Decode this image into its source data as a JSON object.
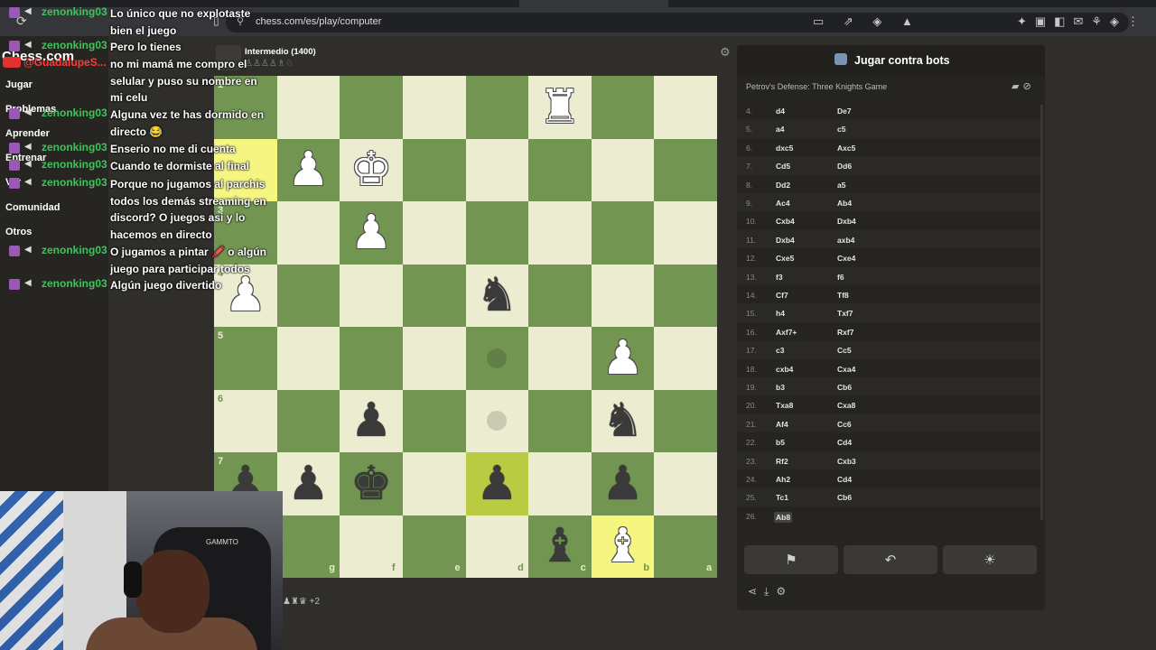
{
  "browser": {
    "url": "chess.com/es/play/computer"
  },
  "nav": {
    "logo": "Chess.com",
    "items": [
      "Jugar",
      "Problemas",
      "Aprender",
      "Entrenar",
      "Ver",
      "Comunidad",
      "Otros"
    ]
  },
  "chat": {
    "mention": "@GuadalupeS...",
    "messages": [
      {
        "user": "zenonking03",
        "text": "Lo único que no explotaste bien el juego"
      },
      {
        "user": "zenonking03",
        "text": "Pero lo tienes"
      },
      {
        "user": "",
        "text": "no mi mamá me compro el selular y puso su nombre en mi celu"
      },
      {
        "user": "zenonking03",
        "text": "Alguna vez te has dormido en directo 😂"
      },
      {
        "user": "zenonking03",
        "text": "Enserio no me di cuenta"
      },
      {
        "user": "zenonking03",
        "text": "Cuando te dormiste al final"
      },
      {
        "user": "zenonking03",
        "text": "Porque no jugamos al parchis todos los demás streaming en discord? O juegos asi y lo hacemos en directo"
      },
      {
        "user": "zenonking03",
        "text": "O jugamos a pintar 🖍️ o algún juego para participar todos"
      },
      {
        "user": "zenonking03",
        "text": "Algún juego divertido"
      }
    ]
  },
  "opponent": {
    "name": "Intermedio (1400)",
    "captured": "♙♙♙♙♗♘"
  },
  "board": {
    "ranks": [
      "1",
      "2",
      "3",
      "4",
      "5",
      "6",
      "7"
    ],
    "files": [
      "g",
      "f",
      "e",
      "d",
      "c",
      "b",
      "a"
    ]
  },
  "player": {
    "captured": "♟♜♛ +2"
  },
  "webcam": {
    "chair_brand": "GAMMTO"
  },
  "panel": {
    "title": "Jugar contra bots",
    "opening": "Petrov's Defense: Three Knights Game",
    "moves": [
      {
        "n": "4.",
        "w": "d4",
        "b": "De7"
      },
      {
        "n": "5.",
        "w": "a4",
        "b": "c5"
      },
      {
        "n": "6.",
        "w": "dxc5",
        "b": "Axc5"
      },
      {
        "n": "7.",
        "w": "Cd5",
        "b": "Dd6"
      },
      {
        "n": "8.",
        "w": "Dd2",
        "b": "a5"
      },
      {
        "n": "9.",
        "w": "Ac4",
        "b": "Ab4"
      },
      {
        "n": "10.",
        "w": "Cxb4",
        "b": "Dxb4"
      },
      {
        "n": "11.",
        "w": "Dxb4",
        "b": "axb4"
      },
      {
        "n": "12.",
        "w": "Cxe5",
        "b": "Cxe4"
      },
      {
        "n": "13.",
        "w": "f3",
        "b": "f6"
      },
      {
        "n": "14.",
        "w": "Cf7",
        "b": "Tf8"
      },
      {
        "n": "15.",
        "w": "h4",
        "b": "Txf7"
      },
      {
        "n": "16.",
        "w": "Axf7+",
        "b": "Rxf7"
      },
      {
        "n": "17.",
        "w": "c3",
        "b": "Cc5"
      },
      {
        "n": "18.",
        "w": "cxb4",
        "b": "Cxa4"
      },
      {
        "n": "19.",
        "w": "b3",
        "b": "Cb6"
      },
      {
        "n": "20.",
        "w": "Txa8",
        "b": "Cxa8"
      },
      {
        "n": "21.",
        "w": "Af4",
        "b": "Cc6"
      },
      {
        "n": "22.",
        "w": "b5",
        "b": "Cd4"
      },
      {
        "n": "23.",
        "w": "Rf2",
        "b": "Cxb3"
      },
      {
        "n": "24.",
        "w": "Ah2",
        "b": "Cd4"
      },
      {
        "n": "25.",
        "w": "Tc1",
        "b": "Cb6"
      },
      {
        "n": "26.",
        "w": "Ab8",
        "b": ""
      }
    ]
  }
}
